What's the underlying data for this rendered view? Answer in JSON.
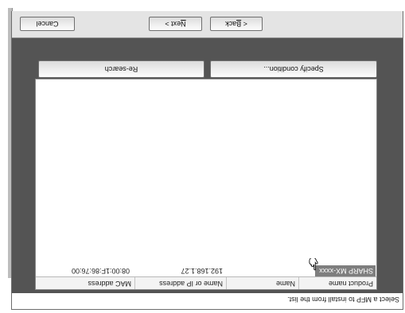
{
  "instruction": "Select a MFP to install from the list.",
  "device_list": {
    "columns": [
      "Product name",
      "Name",
      "Name or IP address",
      "MAC address"
    ],
    "rows": [
      {
        "product": "SHARP MX-xxxx",
        "name": "",
        "ip": "192.168.1.27",
        "mac": "08:00:1F:86:76:00"
      }
    ]
  },
  "buttons": {
    "specify_condition": "Specify condition...",
    "re_search": "Re-search",
    "back_prefix": "< ",
    "back_mnemonic": "B",
    "back_rest": "ack",
    "next_mnemonic": "N",
    "next_rest": "ext >",
    "cancel": "Cancel"
  },
  "icons": {
    "pointer": "hand-pointer-icon"
  }
}
